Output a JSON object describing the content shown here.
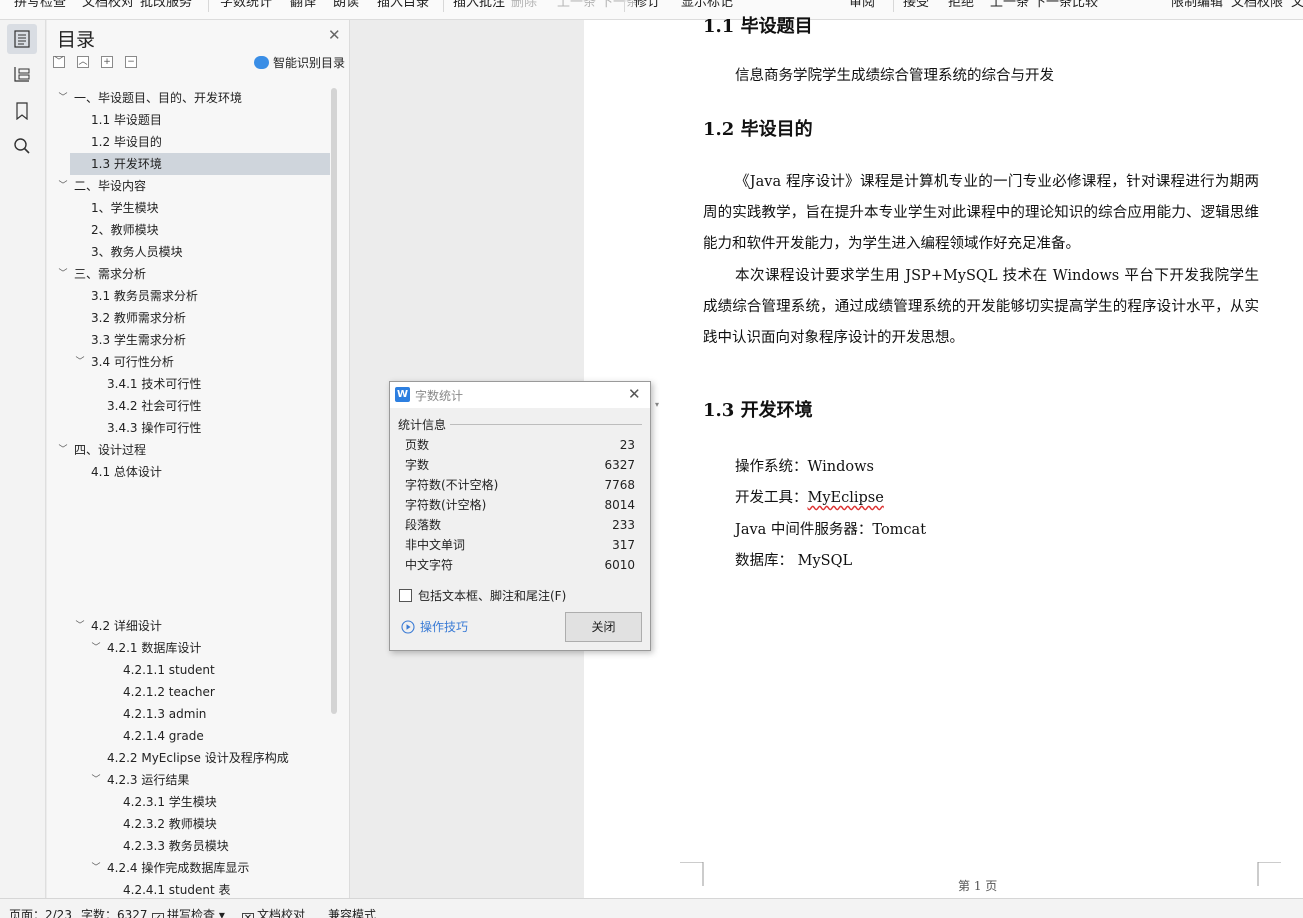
{
  "toolbar": {
    "items": [
      "拼写检查",
      "文档校对",
      "批改服务",
      "字数统计",
      "翻译",
      "朗读",
      "插入目录",
      "插入批注",
      "删除",
      "上一条",
      "下一条",
      "修订",
      "显示标记",
      "审阅",
      "接受",
      "拒绝",
      "上一条",
      "下一条",
      "比较",
      "限制编辑",
      "文档权限",
      "文"
    ]
  },
  "rail": {
    "icons": [
      "outline-icon",
      "chapter-icon",
      "bookmark-icon",
      "search-icon"
    ]
  },
  "outline": {
    "title": "目录",
    "smart_label": "智能识别目录",
    "items": [
      {
        "label": "一、毕设题目、目的、开发环境",
        "arrow": "﹀"
      },
      {
        "label": "1.1 毕设题目",
        "arrow": ""
      },
      {
        "label": "1.2 毕设目的",
        "arrow": ""
      },
      {
        "label": "1.3 开发环境",
        "arrow": ""
      },
      {
        "label": "二、毕设内容",
        "arrow": "﹀"
      },
      {
        "label": "1、学生模块",
        "arrow": ""
      },
      {
        "label": "2、教师模块",
        "arrow": ""
      },
      {
        "label": "3、教务人员模块",
        "arrow": ""
      },
      {
        "label": "三、需求分析",
        "arrow": "﹀"
      },
      {
        "label": "3.1 教务员需求分析",
        "arrow": ""
      },
      {
        "label": "3.2 教师需求分析",
        "arrow": ""
      },
      {
        "label": "3.3 学生需求分析",
        "arrow": ""
      },
      {
        "label": "3.4 可行性分析",
        "arrow": "﹀"
      },
      {
        "label": "3.4.1 技术可行性",
        "arrow": ""
      },
      {
        "label": "3.4.2 社会可行性",
        "arrow": ""
      },
      {
        "label": "3.4.3 操作可行性",
        "arrow": ""
      },
      {
        "label": "四、设计过程",
        "arrow": "﹀"
      },
      {
        "label": "4.1 总体设计",
        "arrow": ""
      },
      {
        "label": "4.2 详细设计",
        "arrow": "﹀"
      },
      {
        "label": "4.2.1 数据库设计",
        "arrow": "﹀"
      },
      {
        "label": "4.2.1.1 student",
        "arrow": ""
      },
      {
        "label": "4.2.1.2 teacher",
        "arrow": ""
      },
      {
        "label": "4.2.1.3 admin",
        "arrow": ""
      },
      {
        "label": "4.2.1.4 grade",
        "arrow": ""
      },
      {
        "label": "4.2.2 MyEclipse 设计及程序构成",
        "arrow": ""
      },
      {
        "label": "4.2.3 运行结果",
        "arrow": "﹀"
      },
      {
        "label": "4.2.3.1  学生模块",
        "arrow": ""
      },
      {
        "label": "4.2.3.2  教师模块",
        "arrow": ""
      },
      {
        "label": "4.2.3.3  教务员模块",
        "arrow": ""
      },
      {
        "label": "4.2.4  操作完成数据库显示",
        "arrow": "﹀"
      },
      {
        "label": "4.2.4.1 student 表",
        "arrow": ""
      }
    ]
  },
  "document": {
    "h_11": "1.1 毕设题目",
    "p_title": "信息商务学院学生成绩综合管理系统的综合与开发",
    "h_12": "1.2 毕设目的",
    "p1": "《Java 程序设计》课程是计算机专业的一门专业必修课程，针对课程进行为期两周的实践教学，旨在提升本专业学生对此课程中的理论知识的综合应用能力、逻辑思维能力和软件开发能力，为学生进入编程领域作好充足准备。",
    "p2": "本次课程设计要求学生用 JSP+MySQL 技术在 Windows 平台下开发我院学生成绩综合管理系统，通过成绩管理系统的开发能够切实提高学生的程序设计水平，从实践中认识面向对象程序设计的开发思想。",
    "h_13": "1.3 开发环境",
    "env_os": "操作系统：Windows",
    "env_tool_label": "开发工具：",
    "env_tool_value": "MyEclipse",
    "env_server": "Java 中间件服务器：Tomcat",
    "env_db": "数据库：  MySQL",
    "page_number": "第 1 页"
  },
  "dialog": {
    "title": "字数统计",
    "section": "统计信息",
    "stats": [
      {
        "label": "页数",
        "value": "23"
      },
      {
        "label": "字数",
        "value": "6327"
      },
      {
        "label": "字符数(不计空格)",
        "value": "7768"
      },
      {
        "label": "字符数(计空格)",
        "value": "8014"
      },
      {
        "label": "段落数",
        "value": "233"
      },
      {
        "label": "非中文单词",
        "value": "317"
      },
      {
        "label": "中文字符",
        "value": "6010"
      }
    ],
    "checkbox_label": "包括文本框、脚注和尾注(F)",
    "tips_label": "操作技巧",
    "close_label": "关闭"
  },
  "status": {
    "page": "页面：2/23",
    "words": "字数：6327",
    "spell": "拼写检查",
    "proof": "文档校对",
    "compat": "兼容模式"
  }
}
